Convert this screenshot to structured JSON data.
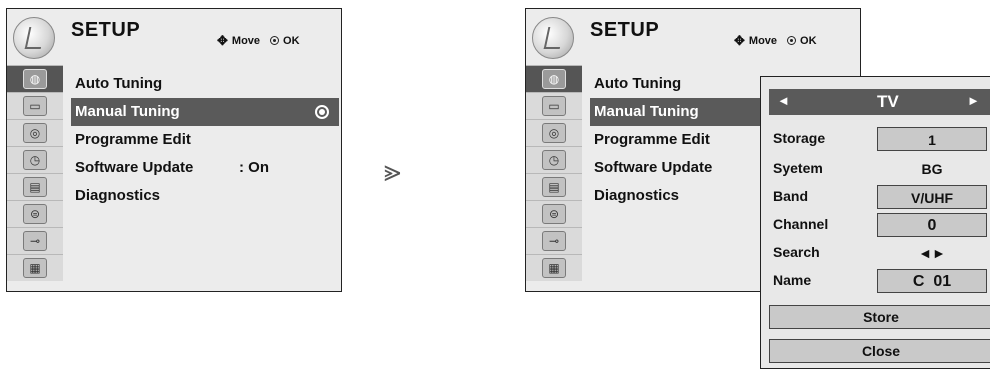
{
  "left_menu": {
    "title": "SETUP",
    "hint_move": "Move",
    "hint_ok": "OK",
    "items": [
      {
        "label": "Auto Tuning"
      },
      {
        "label": "Manual Tuning",
        "selected": true
      },
      {
        "label": "Programme Edit"
      },
      {
        "label": "Software Update",
        "value": ": On"
      },
      {
        "label": "Diagnostics"
      }
    ],
    "side_icons": [
      "globe-icon",
      "tv-icon",
      "speaker-icon",
      "clock-icon",
      "option-icon",
      "lock-icon",
      "input-plug-icon",
      "clapper-icon"
    ]
  },
  "arrow": "⪢",
  "right_menu": {
    "title": "SETUP",
    "hint_move": "Move",
    "hint_ok": "OK",
    "items": [
      {
        "label": "Auto Tuning"
      },
      {
        "label": "Manual Tuning",
        "selected": true
      },
      {
        "label": "Programme Edit"
      },
      {
        "label": "Software Update"
      },
      {
        "label": "Diagnostics"
      }
    ]
  },
  "popup": {
    "left_arrow": "◄",
    "mode": "TV",
    "right_arrow": "►",
    "rows": [
      {
        "label": "Storage",
        "value": "1"
      },
      {
        "label": "Syetem",
        "value": "BG"
      },
      {
        "label": "Band",
        "value": "V/UHF"
      },
      {
        "label": "Channel",
        "value": "0"
      },
      {
        "label": "Search",
        "value": "◄►"
      },
      {
        "label": "Name",
        "value": "C  01"
      }
    ],
    "store_label": "Store",
    "close_label": "Close"
  },
  "colors": {
    "panel": "#ececec",
    "highlight": "#5a5a5a",
    "field": "#c9c9c9"
  }
}
